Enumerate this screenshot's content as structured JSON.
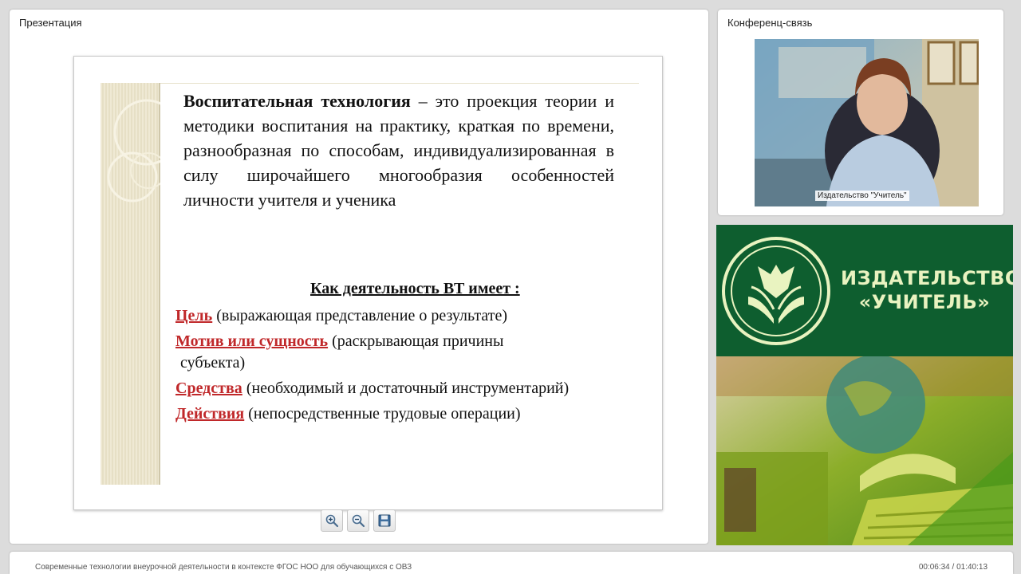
{
  "presentation": {
    "title": "Презентация",
    "slide": {
      "definition_term": "Воспитательная технология",
      "definition_rest": " – это проекция теории и методики воспитания на практику, краткая по времени, разнообразная по способам, индивидуализированная в силу широчайшего многообразия особенностей личности учителя и ученика",
      "heading": "Как деятельность ВТ имеет :",
      "items": [
        {
          "term": "Цель",
          "desc": " (выражающая представление  о результате)",
          "cont": ""
        },
        {
          "term": "Мотив или сущность",
          "desc": " (раскрывающая причины",
          "cont": "субъекта)"
        },
        {
          "term": "Средства",
          "desc": " (необходимый и достаточный инструментарий)",
          "cont": ""
        },
        {
          "term": "Действия",
          "desc": " (непосредственные трудовые операции)",
          "cont": ""
        }
      ]
    },
    "toolbar": {
      "zoom_in_icon": "zoom-in-icon",
      "zoom_out_icon": "zoom-out-icon",
      "save_icon": "floppy-disk-icon"
    }
  },
  "conference": {
    "title": "Конференц-связь",
    "participant_label": "Издательство \"Учитель\""
  },
  "banner": {
    "publisher_line1": "ИЗДАТЕЛЬСТВО",
    "publisher_line2": "«УЧИТЕЛЬ»"
  },
  "footer": {
    "title": "Современные технологии внеурочной деятельности в контексте ФГОС НОО для обучающихся с ОВЗ",
    "time": "00:06:34 / 01:40:13"
  },
  "colors": {
    "term_red": "#c0282a",
    "banner_green": "#0e5e2f",
    "banner_text": "#e9f3c0"
  }
}
